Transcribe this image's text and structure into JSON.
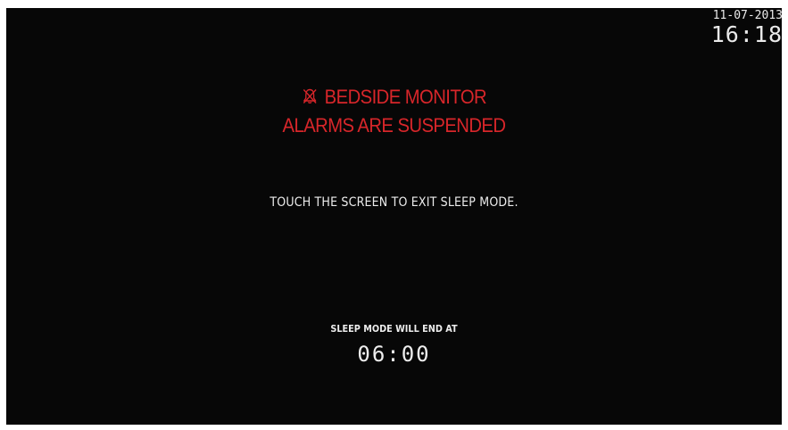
{
  "clock": {
    "date": "11-07-2013",
    "time": "16:18"
  },
  "alarm": {
    "icon": "bell-off-icon",
    "line1": "BEDSIDE MONITOR",
    "line2": "ALARMS ARE SUSPENDED",
    "color": "#d8262a"
  },
  "instructions": {
    "touch_message": "TOUCH THE SCREEN TO EXIT SLEEP MODE."
  },
  "sleep": {
    "label": "SLEEP MODE WILL END AT",
    "end_time": "06:00"
  },
  "colors": {
    "background": "#070707",
    "text": "#e8e8e8",
    "alarm": "#d8262a"
  }
}
